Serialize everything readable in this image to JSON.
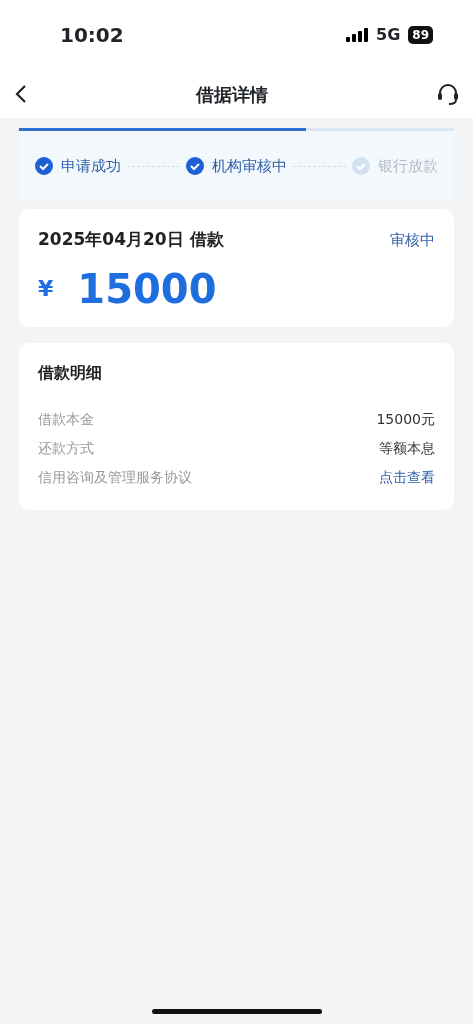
{
  "status_bar": {
    "time": "10:02",
    "network": "5G",
    "battery": "89"
  },
  "nav": {
    "title": "借据详情"
  },
  "progress": {
    "level": 0.66,
    "steps": [
      {
        "label": "申请成功",
        "done": true
      },
      {
        "label": "机构审核中",
        "done": true
      },
      {
        "label": "银行放款",
        "done": false
      }
    ]
  },
  "loan": {
    "title": "2025年04月20日 借款",
    "status": "审核中",
    "currency": "¥",
    "amount": "15000"
  },
  "details": {
    "title": "借款明细",
    "rows": [
      {
        "label": "借款本金",
        "value": "15000元",
        "kind": "text"
      },
      {
        "label": "还款方式",
        "value": "等额本息",
        "kind": "text"
      },
      {
        "label": "信用咨询及管理服务协议",
        "value": "点击查看",
        "kind": "link"
      }
    ]
  }
}
